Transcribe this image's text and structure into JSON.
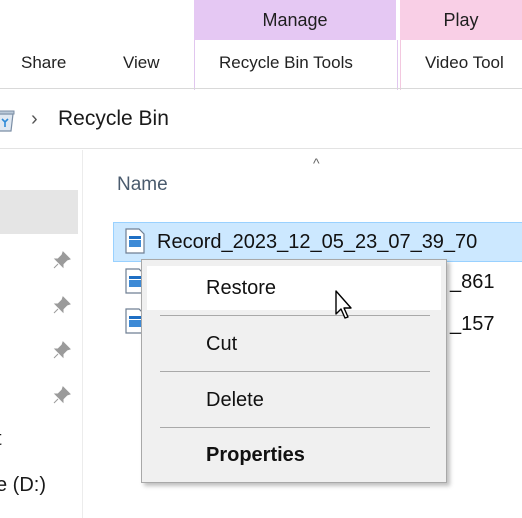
{
  "ribbon": {
    "contextual_tabs": {
      "manage": "Manage",
      "play": "Play"
    },
    "tabs": {
      "share": "Share",
      "view": "View",
      "recycle_bin_tools": "Recycle Bin Tools",
      "video_tools": "Video Tool"
    },
    "colors": {
      "manage": "#e5c8f3",
      "play": "#f9cfe6"
    }
  },
  "address_bar": {
    "icon": "recycle-bin-icon",
    "separator": "›",
    "location": "Recycle Bin"
  },
  "nav_pane": {
    "items": [
      {
        "label": "t",
        "icon": "drive-icon"
      },
      {
        "label": "e (D:)",
        "icon": "drive-icon"
      }
    ],
    "pin_icon": "pin-icon",
    "pin_count": 4
  },
  "file_list": {
    "column_header": "Name",
    "sort_indicator": "^",
    "files": [
      {
        "name": "Record_2023_12_05_23_07_39_70",
        "selected": true
      },
      {
        "name": "_861",
        "selected": false
      },
      {
        "name": "_157",
        "selected": false
      }
    ]
  },
  "context_menu": {
    "items": [
      {
        "label": "Restore",
        "hovered": true
      },
      {
        "label": "Cut"
      },
      {
        "label": "Delete"
      },
      {
        "label": "Properties",
        "bold": true
      }
    ]
  },
  "colors": {
    "selection": "#cce8ff",
    "selection_border": "#99d1ff",
    "menu_bg": "#f0f0f0"
  }
}
